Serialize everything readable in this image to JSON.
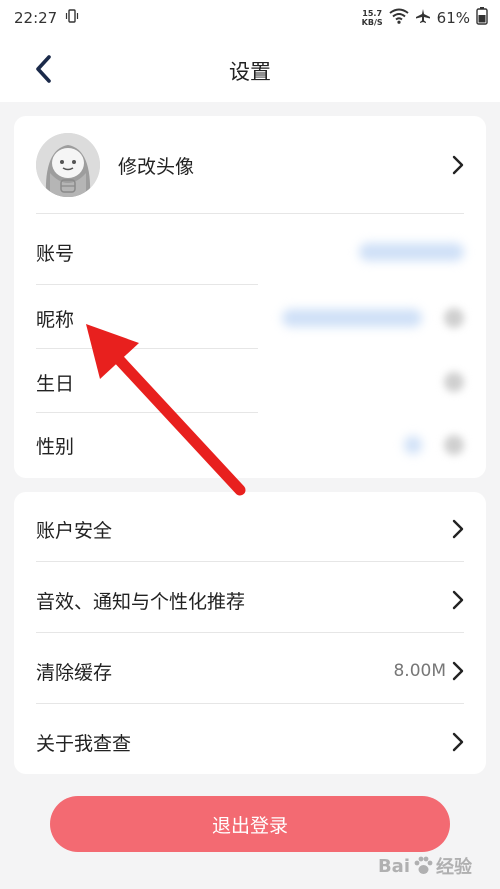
{
  "status_bar": {
    "time": "22:27",
    "net_speed_value": "15.7",
    "net_speed_unit": "KB/S",
    "battery": "61%"
  },
  "header": {
    "title": "设置"
  },
  "profile_card": {
    "avatar_row_label": "修改头像",
    "rows": [
      {
        "label": "账号"
      },
      {
        "label": "昵称"
      },
      {
        "label": "生日"
      },
      {
        "label": "性别"
      }
    ]
  },
  "settings_card": {
    "rows": [
      {
        "label": "账户安全",
        "value": ""
      },
      {
        "label": "音效、通知与个性化推荐",
        "value": ""
      },
      {
        "label": "清除缓存",
        "value": "8.00M"
      },
      {
        "label": "关于我查查",
        "value": ""
      }
    ]
  },
  "logout": {
    "label": "退出登录"
  },
  "watermark": {
    "text": "Bai",
    "suffix": "经验"
  },
  "colors": {
    "accent": "#f36a72",
    "annotation_arrow": "#e8201e",
    "background": "#f4f4f5"
  }
}
